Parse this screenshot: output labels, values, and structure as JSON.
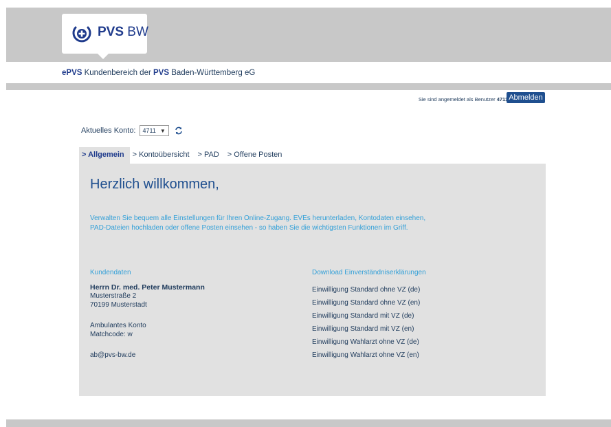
{
  "brand": {
    "logo_bold": "PVS",
    "logo_light": " BW",
    "primary_color": "#1f3b8c",
    "accent_color": "#33a0d8"
  },
  "header": {
    "subtitle_prefix_bold": "ePVS",
    "subtitle_mid": " Kundenbereich der ",
    "subtitle_bold2": "PVS",
    "subtitle_suffix": " Baden-Württemberg eG"
  },
  "session": {
    "login_text": "Sie sind angemeldet als Benutzer ",
    "user_id": "4711",
    "logout_label": "Abmelden"
  },
  "account": {
    "label": "Aktuelles Konto:",
    "selected": "4711",
    "refresh_icon": "refresh-icon"
  },
  "tabs": [
    {
      "label": "> Allgemein",
      "active": true
    },
    {
      "label": "> Kontoübersicht",
      "active": false
    },
    {
      "label": "> PAD",
      "active": false
    },
    {
      "label": "> Offene Posten",
      "active": false
    }
  ],
  "main": {
    "welcome": "Herzlich willkommen,",
    "intro_line1": "Verwalten Sie bequem alle Einstellungen für Ihren Online-Zugang. EVEs herunterladen, Kontodaten einsehen,",
    "intro_line2": "PAD-Dateien hochladen oder offene Posten einsehen - so haben Sie die wichtigsten Funktionen im Griff."
  },
  "customer": {
    "heading": "Kundendaten",
    "name": "Herrn Dr. med. Peter Mustermann",
    "street": "Musterstraße 2",
    "city": "70199 Musterstadt",
    "account_type": "Ambulantes Konto",
    "matchcode": "Matchcode: w",
    "email": "ab@pvs-bw.de"
  },
  "downloads": {
    "heading": "Download Einverständniserklärungen",
    "links": [
      "Einwilligung Standard ohne VZ (de)",
      "Einwilligung Standard ohne VZ (en)",
      "Einwilligung Standard mit VZ (de)",
      "Einwilligung Standard mit VZ (en)",
      "Einwilligung Wahlarzt ohne VZ (de)",
      "Einwilligung Wahlarzt ohne VZ (en)"
    ]
  }
}
